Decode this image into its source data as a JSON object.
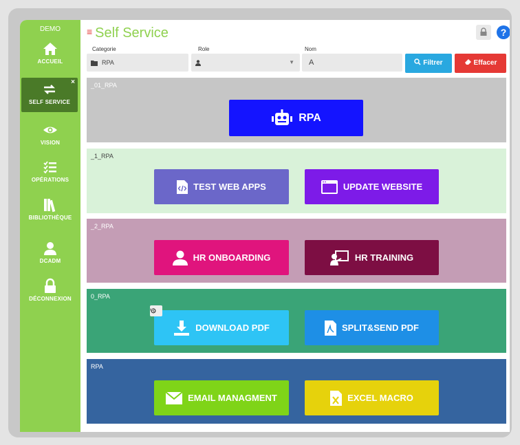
{
  "sidebar": {
    "demo": "DEMO",
    "items": [
      {
        "label": "ACCUEIL"
      },
      {
        "label": "SELF SERVICE",
        "close": "×"
      },
      {
        "label": "VISION"
      },
      {
        "label": "OPÉRATIONS"
      },
      {
        "label": "BIBLIOTHÈQUE"
      },
      {
        "label": "DCADM"
      },
      {
        "label": "DÉCONNEXION"
      }
    ]
  },
  "header": {
    "menu_icon": "≡",
    "title": "Self Service",
    "help": "?"
  },
  "filters": {
    "categorie": {
      "label": "Categorie",
      "value": "RPA"
    },
    "role": {
      "label": "Role",
      "value": ""
    },
    "nom": {
      "label": "Nom",
      "value": "A"
    },
    "filter_btn": "Filtrer",
    "clear_btn": "Effacer"
  },
  "sections": [
    {
      "name": "_01_RPA",
      "tiles": [
        {
          "label": "RPA"
        }
      ]
    },
    {
      "name": "_1_RPA",
      "tiles": [
        {
          "label": "TEST WEB APPS"
        },
        {
          "label": "UPDATE WEBSITE"
        }
      ]
    },
    {
      "name": "_2_RPA",
      "tiles": [
        {
          "label": "HR ONBOARDING"
        },
        {
          "label": "HR TRAINING"
        }
      ]
    },
    {
      "name": "0_RPA",
      "tiles": [
        {
          "label": "DOWNLOAD PDF"
        },
        {
          "label": "SPLIT&SEND PDF"
        }
      ]
    },
    {
      "name": "RPA",
      "tiles": [
        {
          "label": "EMAIL MANAGMENT"
        },
        {
          "label": "EXCEL MACRO"
        }
      ]
    }
  ],
  "colors": {
    "sidebar": "#8fd14f",
    "accent_red": "#e53935",
    "filter_blue": "#29a8e0",
    "sec_0": "#c6c6c6",
    "sec_1": "#d9f2d9",
    "sec_2": "#c49db5",
    "sec_3": "#3aa477",
    "sec_4": "#35649f"
  }
}
